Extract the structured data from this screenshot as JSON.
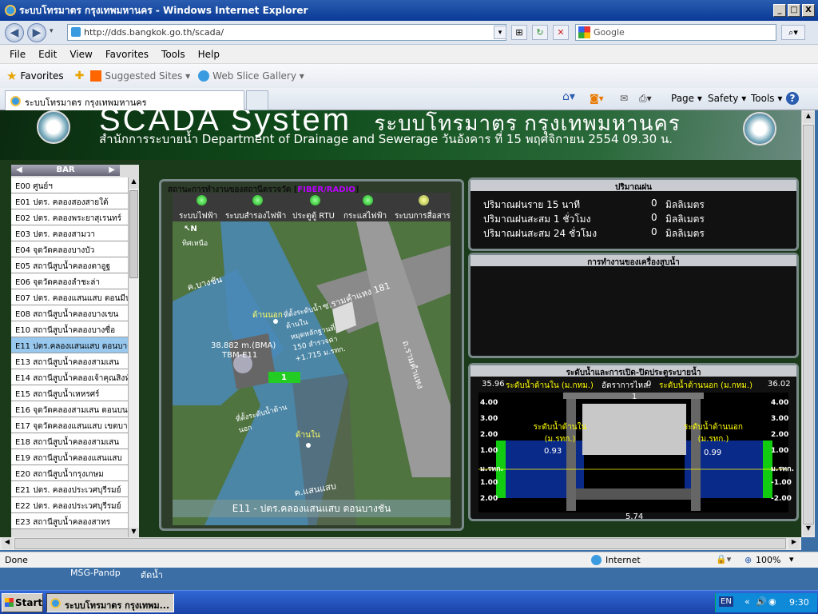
{
  "window": {
    "title": "ระบบโทรมาตร กรุงเทพมหานคร - Windows Internet Explorer",
    "min": "_",
    "max": "□",
    "close": "X"
  },
  "address": {
    "url": "http://dds.bangkok.go.th/scada/",
    "search_placeholder": "Google"
  },
  "menu": [
    "File",
    "Edit",
    "View",
    "Favorites",
    "Tools",
    "Help"
  ],
  "favbar": {
    "favorites": "Favorites",
    "suggested": "Suggested Sites ▾",
    "slice": "Web Slice Gallery ▾"
  },
  "tab": {
    "title": "ระบบโทรมาตร กรุงเทพมหานคร"
  },
  "commands": {
    "page": "Page ▾",
    "safety": "Safety ▾",
    "tools": "Tools ▾"
  },
  "scada": {
    "title": "SCADA System",
    "title_thai": "ระบบโทรมาตร กรุงเทพมหานคร",
    "subtitle": "สำนักการระบายน้ำ  Department of Drainage and Sewerage วันอังคาร ที่ 15 พฤศจิกายน 2554 09.30 น.",
    "bar_label": "BAR",
    "stations": [
      "E00  ศูนย์ฯ",
      "E01  ปตร. คลองสองสายใต้",
      "E02  ปตร. คลองพระยาสุเรนทร์",
      "E03  ปตร. คลองสามวา",
      "E04  จุดวัดคลองบางบัว",
      "E05  สถานีสูบน้ำคลองตาอูฐ",
      "E06  จุดวัดคลองลำชะล่า",
      "E07  ปตร. คลองแสนแสบ ตอนมีนบุรี",
      "E08  สถานีสูบน้ำคลองบางเขน",
      "E10  สถานีสูบน้ำคลองบางซื่อ",
      "E11  ปตร.คลองแสนแสบ ตอนบางชัน",
      "E13  สถานีสูบน้ำคลองสามเสน",
      "E14  สถานีสูบน้ำคลองเจ้าคุณสิงห์",
      "E15  สถานีสูบน้ำเหหรศร์",
      "E16  จุดวัดคลองสามเสน ตอนบน",
      "E17  จุดวัดคลองแสนแสบ เขตบางกะปิ",
      "E18  สถานีสูบน้ำคลองสามเสน",
      "E19  สถานีสูบน้ำคลองแสนแสบ",
      "E20  สถานีสูบน้ำกรุงเกษม",
      "E21  ปตร. คลองประเวศบุรีรมย์",
      "E22  ปตร. คลองประเวศบุรีรมย์",
      "E23  สถานีสูบน้ำคลองสาทร"
    ],
    "selected_index": 10,
    "map_panel": {
      "title_prefix": "สถานะการทำงานของสถานีตรวจวัด [",
      "title_mid": "FIBER/RADIO",
      "title_suffix": "]",
      "status_labels": [
        "ระบบไฟฟ้า",
        "ระบบสำรองไฟฟ้า",
        "ประตูตู้ RTU",
        "กระแสไฟฟ้า",
        "ระบบการสื่อสาร"
      ],
      "map_labels": {
        "north": "ทิศเหนือ",
        "north_symbol": "N",
        "khlong_bangchan": "ค.บางชัน",
        "soi": "ซ.รามคำแหง 181",
        "road": "ถ.รามคำแหง",
        "khlong_saensaep": "ค.แสนแสบ",
        "outside": "ด้านนอก",
        "inside": "ด้านใน",
        "bm": "38.882 m.(BMA)",
        "bm_code": "TBM-E11",
        "gauge_in": "ที่ตั้งระดับน้ำด้านใน",
        "gauge_note": "หมุดหลักฐานที่ 150 สำรวจค่า +1.715 ม.รทก.",
        "gauge_out": "ที่ตั้งระดับน้ำด้านนอก",
        "gate_no": "1"
      },
      "footer": "E11 - ปตร.คลองแสนแสบ ตอนบางชัน"
    },
    "rain_panel": {
      "title": "ปริมาณฝน",
      "rows": [
        {
          "label": "ปริมาณฝนราย 15 นาที",
          "value": "0",
          "unit": "มิลลิเมตร"
        },
        {
          "label": "ปริมาณฝนสะสม 1 ชั่วโมง",
          "value": "0",
          "unit": "มิลลิเมตร"
        },
        {
          "label": "ปริมาณฝนสะสม 24 ชั่วโมง",
          "value": "0",
          "unit": "มิลลิเมตร"
        }
      ]
    },
    "pump_panel": {
      "title": "การทำงานของเครื่องสูบน้ำ"
    },
    "level_panel": {
      "title": "ระดับน้ำและการเปิด-ปิดประตูระบายน้ำ",
      "left_top": "35.96",
      "in_label": "ระดับน้ำด้านใน (ม.กทม.)",
      "flow_label": "อัตราการไหล:",
      "flow_value": "0",
      "out_label": "ระดับน้ำด้านนอก (ม.กทม.)",
      "right_top": "36.02",
      "gate_label": "1",
      "in_caption": "ระดับน้ำด้านใน (ม.รทก.)",
      "out_caption": "ระดับน้ำด้านนอก (ม.รทก.)",
      "in_value": "0.93",
      "out_value": "0.99",
      "bottom_value": "5.74",
      "axis_left": [
        "4.00",
        "3.00",
        "2.00",
        "1.00",
        "ม.รทก.",
        "1.00",
        "2.00"
      ],
      "axis_right": [
        "4.00",
        "3.00",
        "2.00",
        "1.00",
        "ม.รทก.",
        "-1.00",
        "-2.00"
      ]
    }
  },
  "status": {
    "text": "Done",
    "zone": "Internet",
    "zoom": "100%"
  },
  "desktop": {
    "icon1": "MSG-Pandp",
    "icon2": "ตัดน้ำ"
  },
  "taskbar": {
    "start": "Start",
    "task": "ระบบโทรมาตร กรุงเทพม...",
    "lang": "EN",
    "clock": "9:30"
  }
}
